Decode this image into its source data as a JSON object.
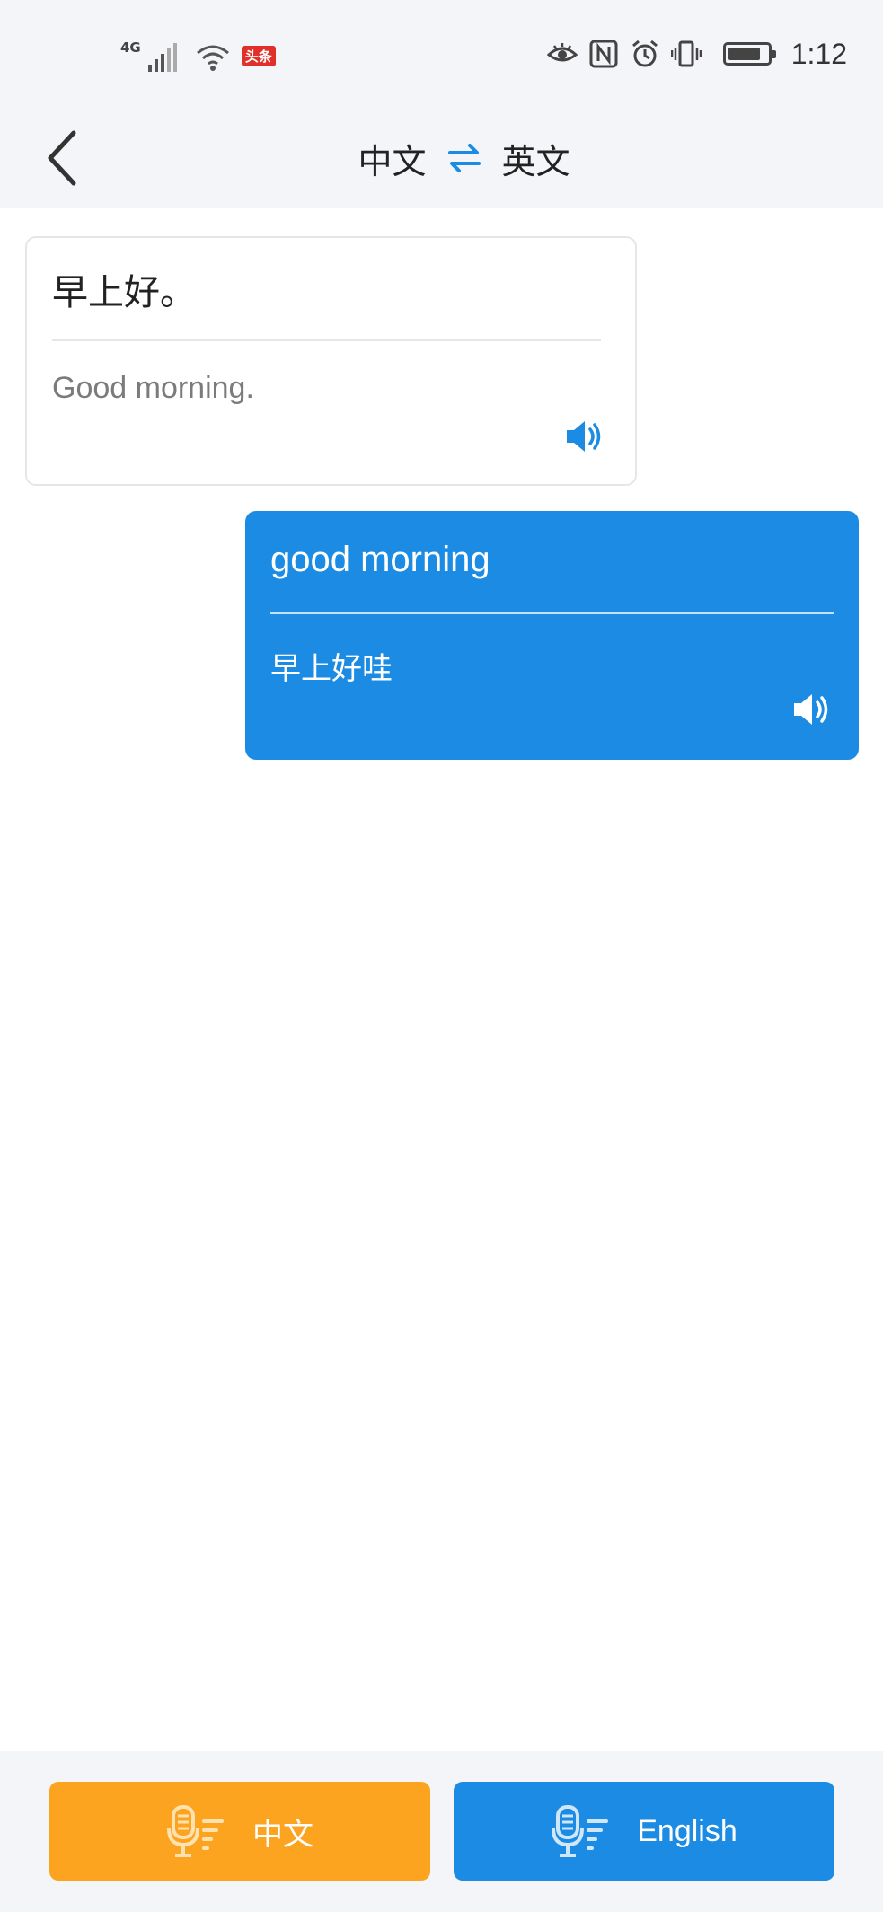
{
  "status_bar": {
    "network": "4G",
    "badge": "头条",
    "time": "1:12",
    "battery_level": 0.85
  },
  "header": {
    "source_language": "中文",
    "target_language": "英文"
  },
  "messages": [
    {
      "source_text": "早上好。",
      "translated_text": "Good morning."
    },
    {
      "source_text": "good morning",
      "translated_text": "早上好哇"
    }
  ],
  "bottom_bar": {
    "left_button_label": "中文",
    "right_button_label": "English"
  },
  "colors": {
    "accent_blue": "#1b8be3",
    "accent_orange": "#fca320",
    "background": "#f4f5f9"
  }
}
